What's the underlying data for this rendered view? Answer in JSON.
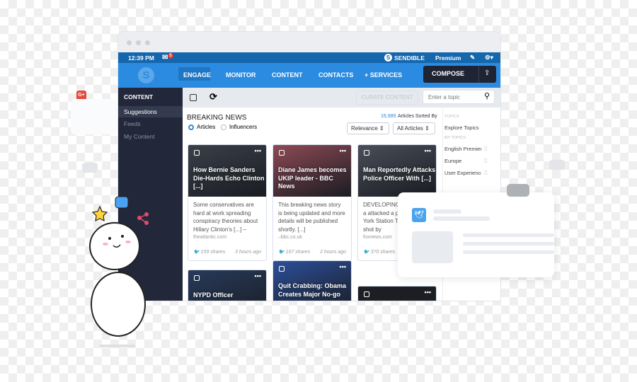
{
  "topbar": {
    "time": "12:39 PM",
    "mail_count": "5",
    "brand": "SENDIBLE",
    "plan": "Premium"
  },
  "nav": {
    "items": [
      "ENGAGE",
      "MONITOR",
      "CONTENT",
      "CONTACTS",
      "+ SERVICES"
    ],
    "compose": "COMPOSE"
  },
  "sidebar": {
    "heading": "CONTENT",
    "items": [
      "Suggestions",
      "Feeds",
      "My Content"
    ]
  },
  "toolbar": {
    "curate": "CURATE CONTENT",
    "search_placeholder": "Enter a topic"
  },
  "main": {
    "title": "BREAKING NEWS",
    "radios": [
      "Articles",
      "Influencers"
    ],
    "count": "16,989",
    "sorted_by": "Articles Sorted By",
    "sort": "Relevance",
    "filter": "All Articles"
  },
  "topics": {
    "label": "TOPICS",
    "explore": "Explore Topics",
    "my_label": "MY TOPICS",
    "items": [
      "English Premier",
      "Europe",
      "User Experience"
    ]
  },
  "cards": [
    {
      "title": "How Bernie Sanders Die-Hards Echo Clinton [...]",
      "body": "Some conservatives are hard at work spreading conspiracy theories about Hillary Clinton's [...] –",
      "source": "theatlantic.com",
      "shares": "159 shares",
      "time": "3 hours ago",
      "color": "#3a3f48"
    },
    {
      "title": "Diane James becomes UKIP leader - BBC News",
      "body": "This breaking news story is being updated and more details will be published shortly. [...]",
      "source": "–bbc.co.uk",
      "shares": "167 shares",
      "time": "2 hours ago",
      "color": "#8e4a55"
    },
    {
      "title": "Man Reportedly Attacks Police Officer With [...]",
      "body": "DEVELOPING armed with a attacked a pol near New York Station Thurs he was shot by",
      "source": "foxnews.com",
      "shares": "370 shares",
      "time": "",
      "color": "#4a4e58"
    },
    {
      "title": "NYPD Officer",
      "color": "#273a5a"
    },
    {
      "title": "Quit Crabbing: Obama Creates Major No-go",
      "color": "#2c4f9a"
    },
    {
      "title": "",
      "color": "#1d1f24"
    }
  ],
  "colors": {
    "accent": "#2a8be0",
    "topbar": "#1466ad",
    "sidebar": "#22283a",
    "twitter": "#4aa3f0"
  }
}
